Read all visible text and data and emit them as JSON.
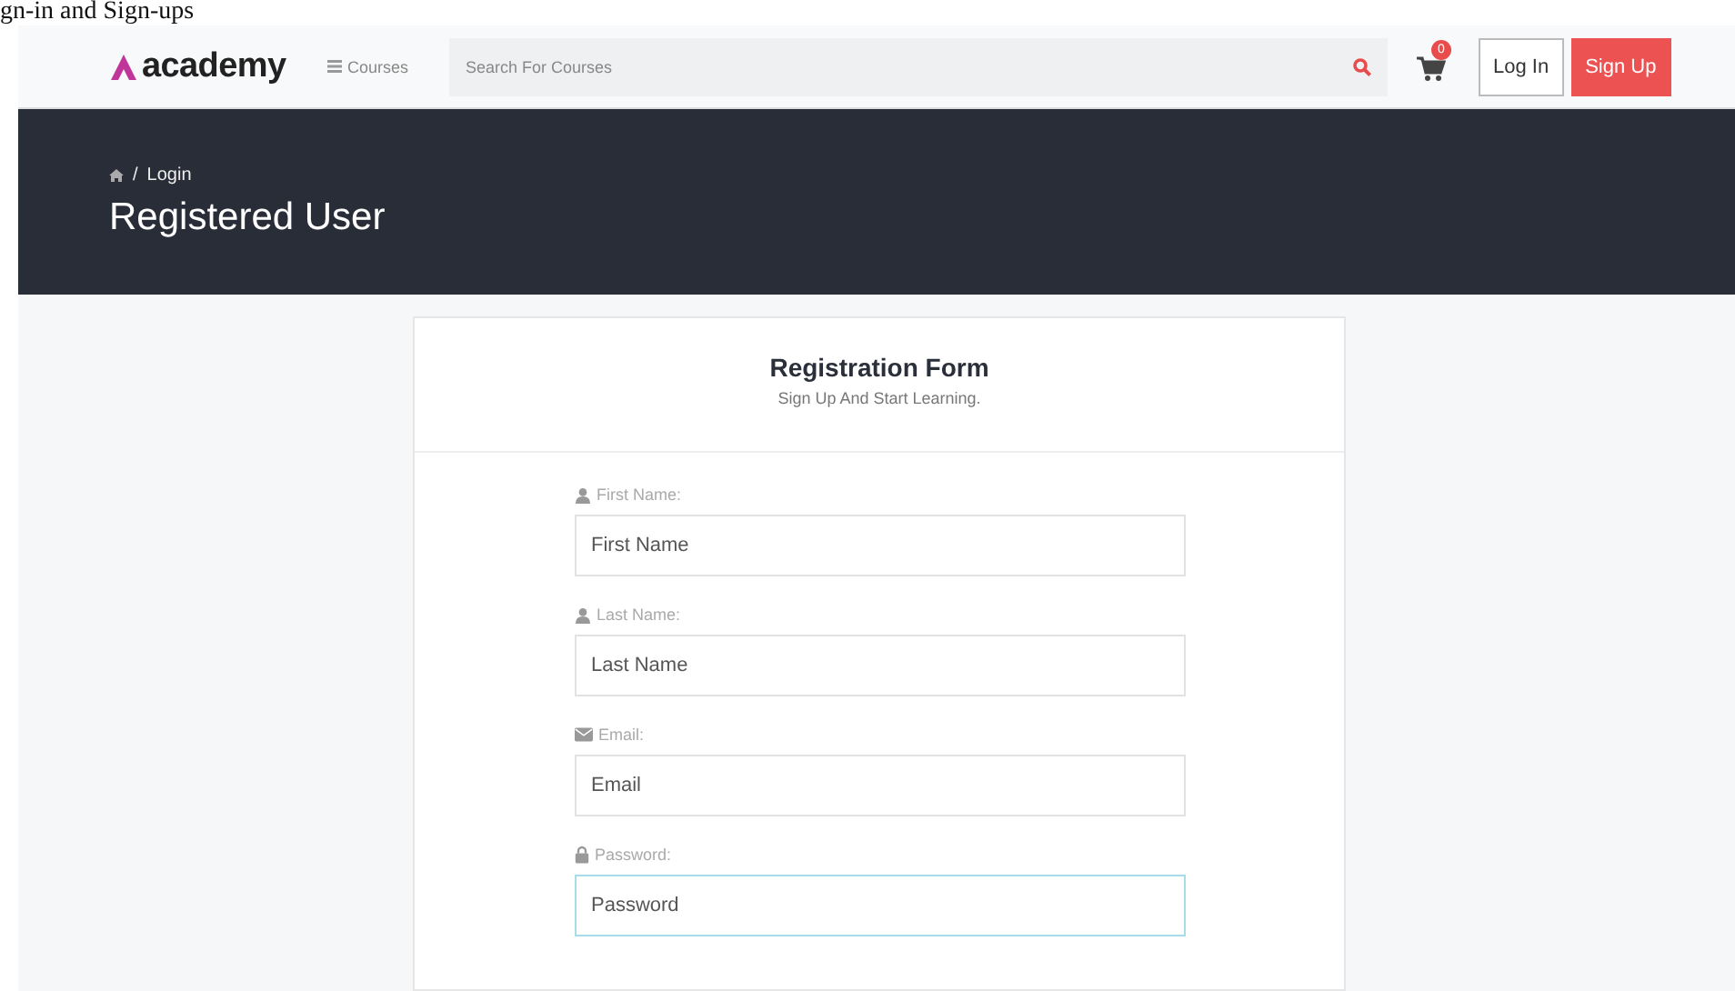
{
  "caption": "gn-in and Sign-ups",
  "header": {
    "logo": "academy",
    "courses": "Courses",
    "search": {
      "placeholder": "Search For Courses"
    },
    "cart_count": "0",
    "buttons": [
      {
        "label": "Log In",
        "kind": "outline"
      },
      {
        "label": "Sign Up",
        "kind": "primary"
      }
    ]
  },
  "banner": {
    "separator": "/",
    "breadcrumb": "Login",
    "title": "Registered User"
  },
  "form": {
    "title": "Registration Form",
    "subtitle": "Sign Up And Start Learning.",
    "fields": [
      {
        "label": "First Name:",
        "kind": "person",
        "placeholder": "First Name",
        "focused": false
      },
      {
        "label": "Last Name:",
        "kind": "person",
        "placeholder": "Last Name",
        "focused": false
      },
      {
        "label": "Email:",
        "kind": "email",
        "placeholder": "Email",
        "focused": false
      },
      {
        "label": "Password:",
        "kind": "lock",
        "placeholder": "Password",
        "focused": true
      }
    ]
  }
}
